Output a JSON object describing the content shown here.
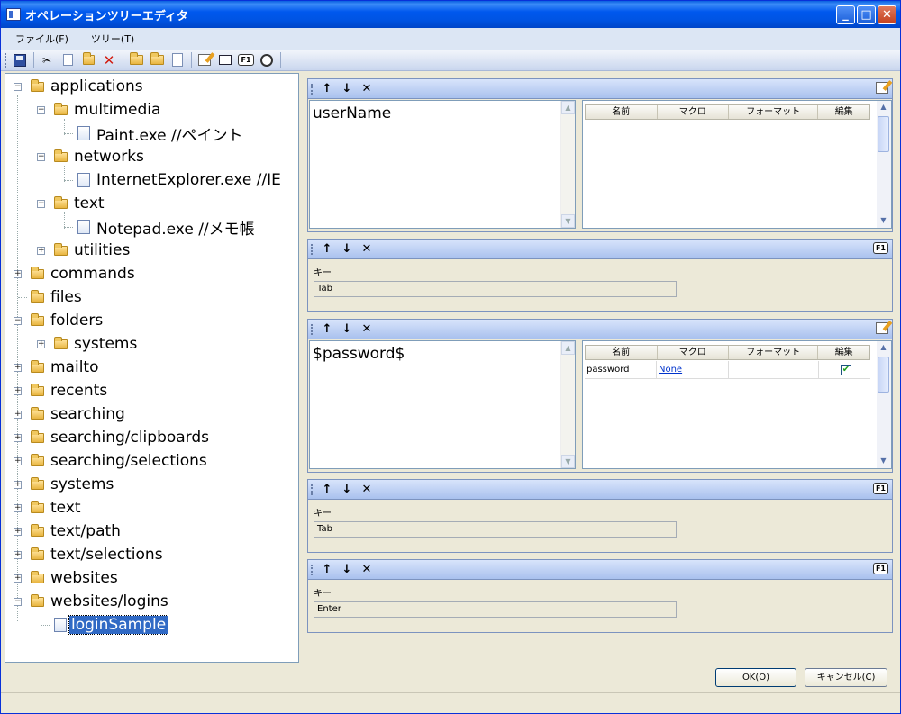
{
  "window": {
    "title": "オペレーションツリーエディタ"
  },
  "menu": [
    "ファイル(F)",
    "ツリー(T)"
  ],
  "toolbar": {
    "icons": [
      "save-icon",
      "cut-icon",
      "copy-icon",
      "paste-icon",
      "delete-icon",
      "new-folder-icon",
      "folder-icon",
      "new-document-icon",
      "edit-icon",
      "window-icon",
      "f1-icon",
      "timer-icon"
    ],
    "f1_label": "F1"
  },
  "tree": {
    "nodes": [
      {
        "label": "applications"
      },
      {
        "label": "multimedia"
      },
      {
        "label": "Paint.exe //ペイント"
      },
      {
        "label": "networks"
      },
      {
        "label": "InternetExplorer.exe //IE"
      },
      {
        "label": "text"
      },
      {
        "label": "Notepad.exe //メモ帳"
      },
      {
        "label": "utilities"
      },
      {
        "label": "commands"
      },
      {
        "label": "files"
      },
      {
        "label": "folders"
      },
      {
        "label": "systems"
      },
      {
        "label": "mailto"
      },
      {
        "label": "recents"
      },
      {
        "label": "searching"
      },
      {
        "label": "searching/clipboards"
      },
      {
        "label": "searching/selections"
      },
      {
        "label": "systems"
      },
      {
        "label": "text"
      },
      {
        "label": "text/path"
      },
      {
        "label": "text/selections"
      },
      {
        "label": "websites"
      },
      {
        "label": "websites/logins"
      },
      {
        "label": "loginSample"
      }
    ]
  },
  "panels": {
    "header_buttons": {
      "up": "↑",
      "down": "↓",
      "remove": "✕"
    },
    "grid_headers": [
      "名前",
      "マクロ",
      "フォーマット",
      "編集"
    ],
    "text1": {
      "value": "userName"
    },
    "key1": {
      "label": "キー",
      "value": "Tab"
    },
    "text2": {
      "value": "$password$",
      "row": {
        "name": "password",
        "macro": "None",
        "format": "",
        "edit_checked": true
      }
    },
    "key2": {
      "label": "キー",
      "value": "Tab"
    },
    "key3": {
      "label": "キー",
      "value": "Enter"
    }
  },
  "buttons": {
    "ok": "OK(O)",
    "cancel": "キャンセル(C)"
  }
}
